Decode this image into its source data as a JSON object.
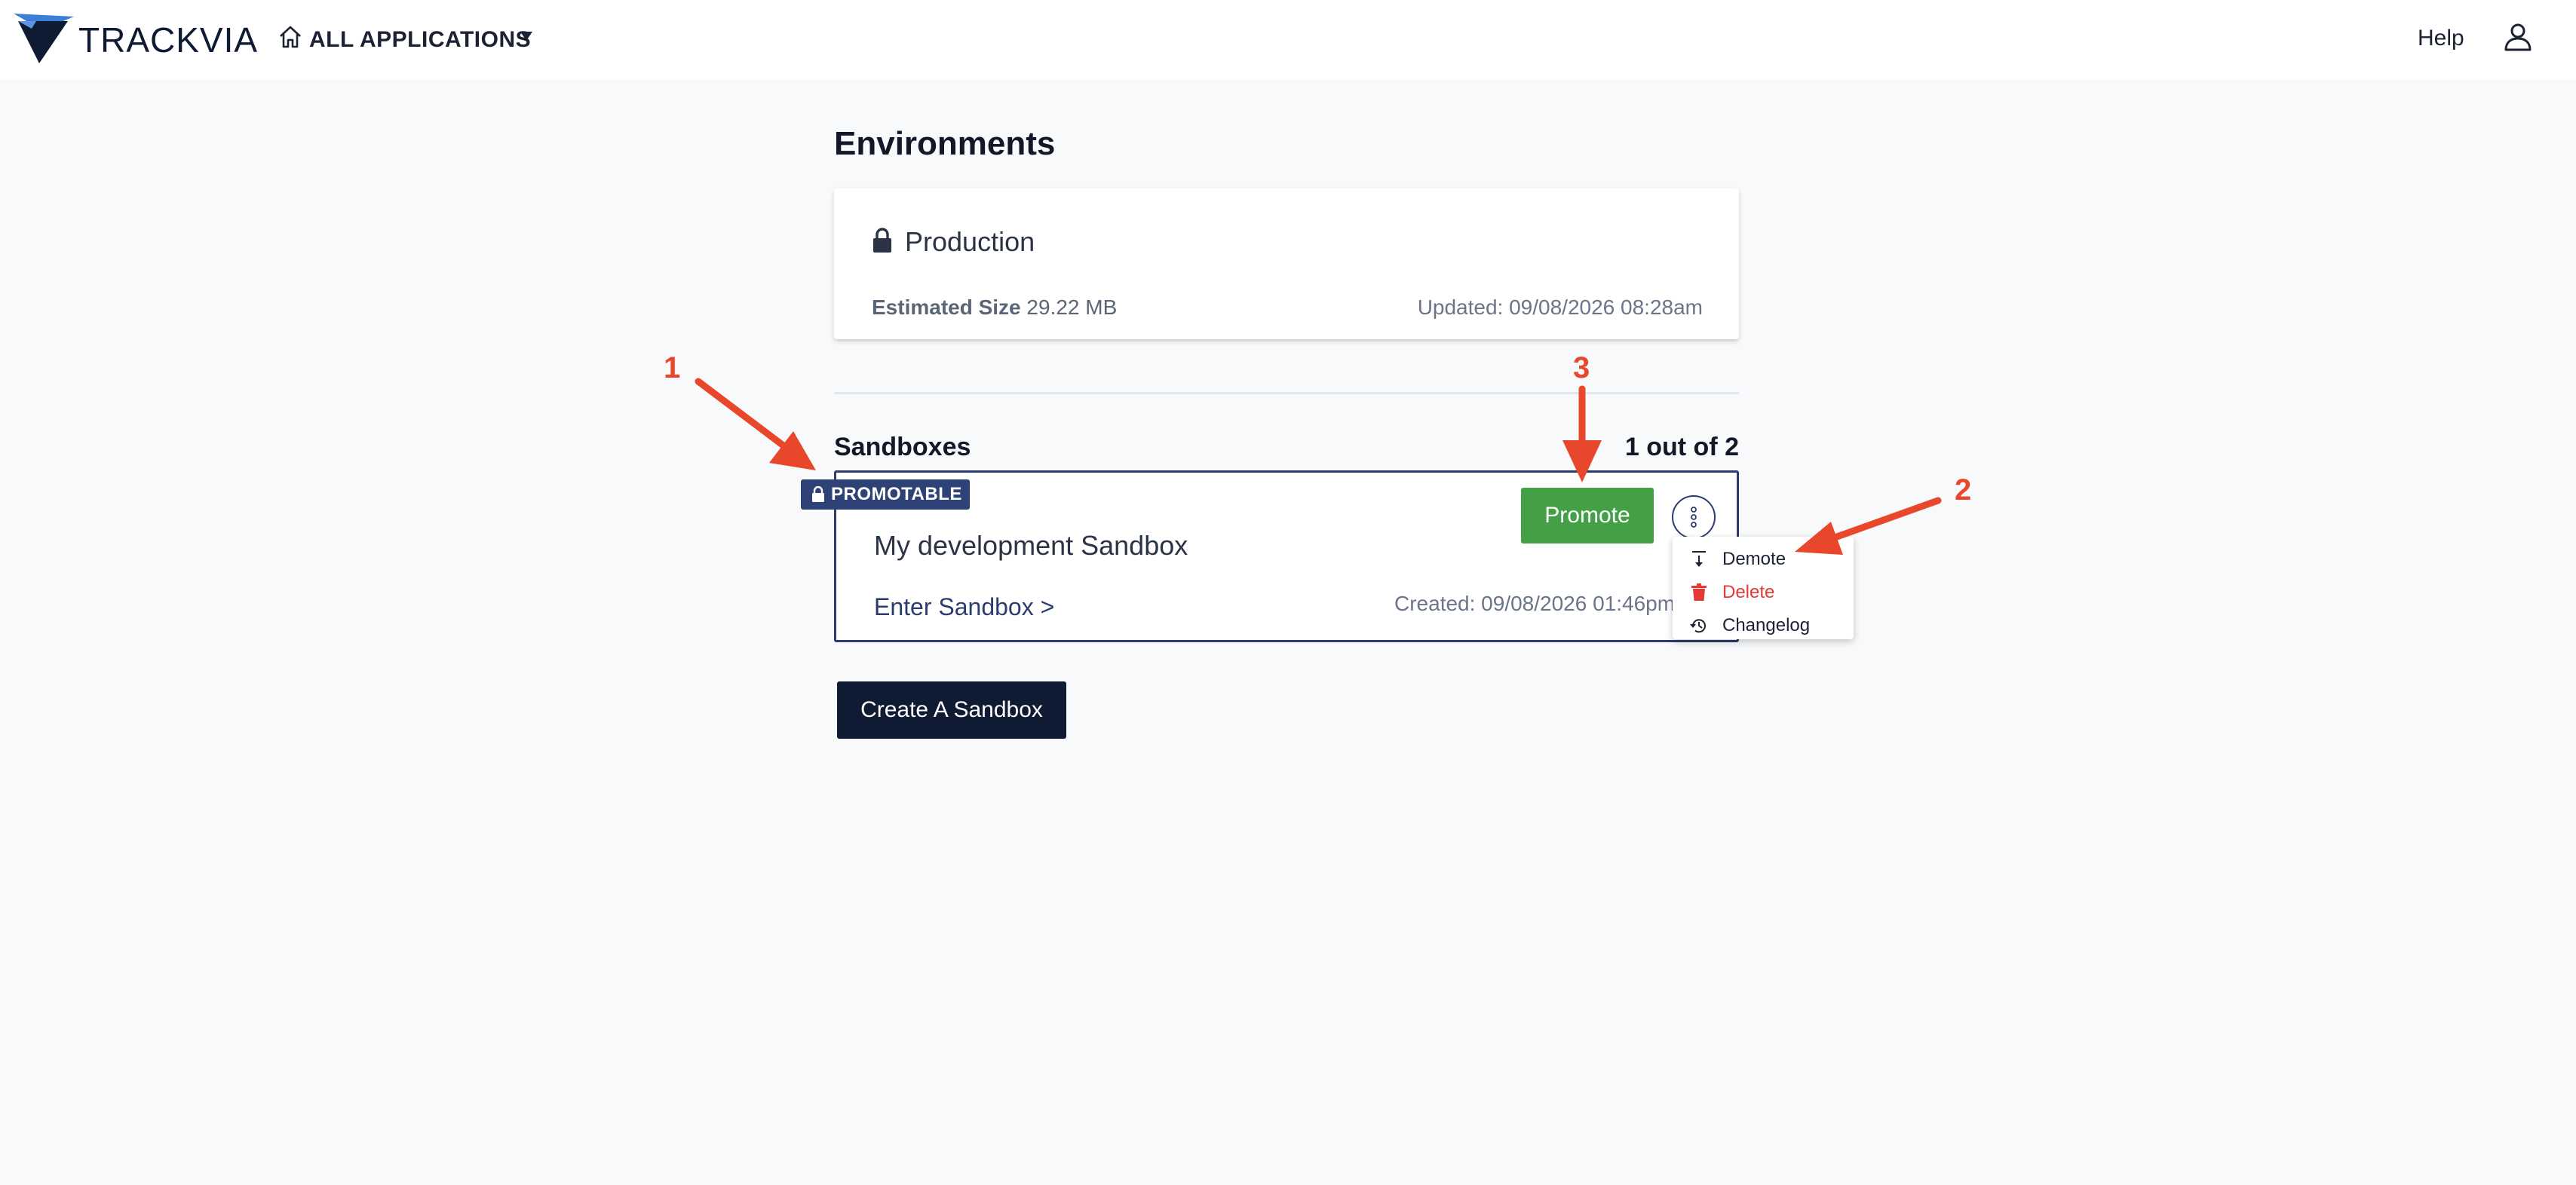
{
  "header": {
    "brand": "TRACKVIA",
    "apps_label": "ALL APPLICATIONS",
    "help_label": "Help"
  },
  "environments": {
    "title": "Environments",
    "production": {
      "name": "Production",
      "size_label": "Estimated Size",
      "size_value": "29.22 MB",
      "updated": "Updated: 09/08/2026 08:28am"
    }
  },
  "sandboxes": {
    "title": "Sandboxes",
    "count": "1 out of 2",
    "items": [
      {
        "badge": "PROMOTABLE",
        "name": "My development Sandbox",
        "enter_label": "Enter Sandbox >",
        "created": "Created: 09/08/2026 01:46pm",
        "promote_label": "Promote"
      }
    ]
  },
  "menu": {
    "items": [
      {
        "label": "Demote",
        "icon": "demote-icon"
      },
      {
        "label": "Delete",
        "icon": "trash-icon"
      },
      {
        "label": "Changelog",
        "icon": "history-icon"
      }
    ]
  },
  "create_label": "Create A Sandbox",
  "annotations": [
    "1",
    "2",
    "3"
  ],
  "colors": {
    "accent": "#2c3c6e",
    "promote": "#43a047",
    "danger": "#e53935",
    "annotation": "#e8472b",
    "dark": "#0f1a33"
  }
}
